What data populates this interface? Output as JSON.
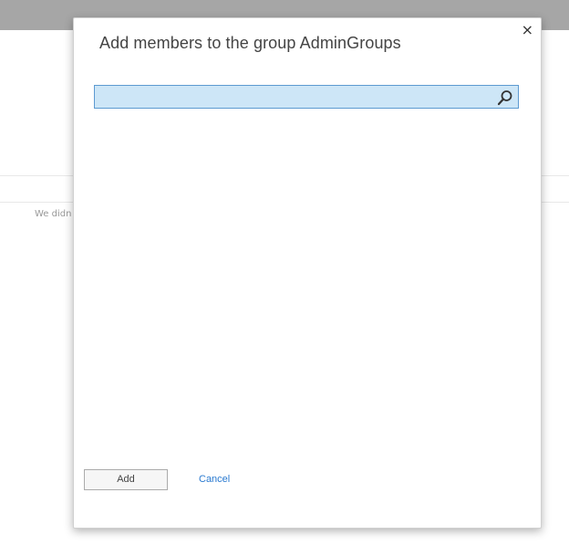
{
  "background": {
    "partial_text": "We didn"
  },
  "dialog": {
    "title": "Add members to the group AdminGroups",
    "close_label": "×",
    "search": {
      "value": "",
      "placeholder": ""
    },
    "add_label": "Add",
    "cancel_label": "Cancel"
  },
  "colors": {
    "accent": "#2a7ad0",
    "search_bg": "#cde6f7",
    "search_border": "#5d9ad1"
  }
}
